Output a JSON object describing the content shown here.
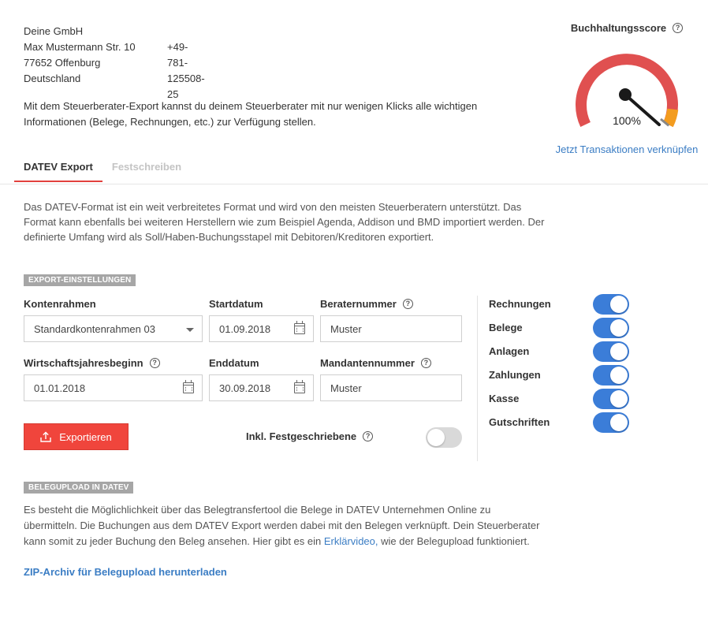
{
  "company": {
    "name": "Deine GmbH",
    "street": "Max Mustermann Str. 10",
    "phone": "+49-781-125508-25",
    "city": "77652 Offenburg",
    "country": "Deutschland"
  },
  "intro": "Mit dem Steuerberater-Export kannst du deinem Steuerberater mit nur wenigen Klicks alle wichtigen Informationen (Belege, Rechnungen, etc.) zur Verfügung stellen.",
  "score": {
    "title": "Buchhaltungsscore",
    "value": "100%",
    "value_fraction": 1.0,
    "link": "Jetzt Transaktionen verknüpfen",
    "colors": {
      "main": "#e05050",
      "end": "#f39c1f"
    }
  },
  "tabs": [
    {
      "label": "DATEV Export",
      "active": true
    },
    {
      "label": "Festschreiben",
      "active": false
    }
  ],
  "description": "Das DATEV-Format ist ein weit verbreitetes Format und wird von den meisten Steuerberatern unterstützt. Das Format kann ebenfalls bei weiteren Herstellern wie zum Beispiel Agenda, Addison und BMD importiert werden. Der definierte Umfang wird als Soll/Haben-Buchungsstapel mit Debitoren/Kreditoren exportiert.",
  "export_settings": {
    "section_title": "EXPORT-EINSTELLUNGEN",
    "kontenrahmen": {
      "label": "Kontenrahmen",
      "value": "Standardkontenrahmen 03"
    },
    "startdatum": {
      "label": "Startdatum",
      "value": "01.09.2018"
    },
    "beraternummer": {
      "label": "Beraternummer",
      "value": "Muster"
    },
    "wirtschaftsjahr": {
      "label": "Wirtschaftsjahresbeginn",
      "value": "01.01.2018"
    },
    "enddatum": {
      "label": "Enddatum",
      "value": "30.09.2018"
    },
    "mandantennummer": {
      "label": "Mandantennummer",
      "value": "Muster"
    },
    "export_button": "Exportieren",
    "festgeschriebene": {
      "label": "Inkl. Festgeschriebene",
      "on": false
    }
  },
  "toggles": [
    {
      "label": "Rechnungen",
      "on": true
    },
    {
      "label": "Belege",
      "on": true
    },
    {
      "label": "Anlagen",
      "on": true
    },
    {
      "label": "Zahlungen",
      "on": true
    },
    {
      "label": "Kasse",
      "on": true
    },
    {
      "label": "Gutschriften",
      "on": true
    }
  ],
  "belegupload": {
    "section_title": "BELEGUPLOAD IN DATEV",
    "text_before": "Es besteht die Möglichlichkeit über das Belegtransfertool die Belege in DATEV Unternehmen Online zu übermitteln. Die Buchungen aus dem DATEV Export werden dabei mit den Belegen verknüpft. Dein Steuerberater kann somit zu jeder Buchung den Beleg ansehen. Hier gibt es ein ",
    "link_text": "Erklärvideo,",
    "text_after": " wie der Belegupload funktioniert.",
    "zip_link": "ZIP-Archiv für Belegupload herunterladen"
  },
  "help_glyph": "?"
}
